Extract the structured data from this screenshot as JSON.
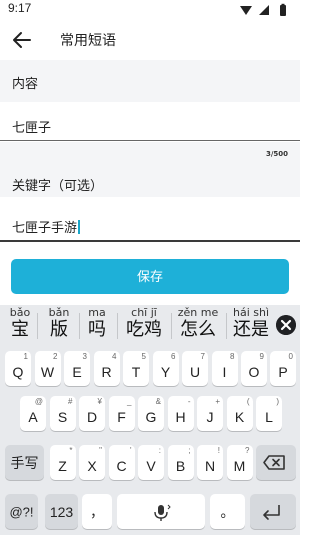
{
  "status": {
    "time": "9:17"
  },
  "app_bar": {
    "title": "常用短语"
  },
  "content": {
    "label": "内容",
    "value": "七匣子",
    "counter": "3/500"
  },
  "keyword": {
    "label": "关键字（可选）",
    "value": "七匣子手游"
  },
  "save_button": {
    "label": "保存"
  },
  "colors": {
    "accent": "#1eb0d8",
    "cursor": "#1aa6c9",
    "keyboard_bg": "#e8eaed",
    "func_key": "#d6d9dd"
  },
  "keyboard": {
    "candidates": [
      {
        "pinyin": "bǎo",
        "hanzi": "宝"
      },
      {
        "pinyin": "bǎn",
        "hanzi": "版"
      },
      {
        "pinyin": "ma",
        "hanzi": "吗"
      },
      {
        "pinyin": "chī jī",
        "hanzi": "吃鸡"
      },
      {
        "pinyin": "zěn me",
        "hanzi": "怎么"
      },
      {
        "pinyin": "hái shì",
        "hanzi": "还是"
      }
    ],
    "row1": [
      {
        "key": "Q",
        "sup": "1"
      },
      {
        "key": "W",
        "sup": "2"
      },
      {
        "key": "E",
        "sup": "3"
      },
      {
        "key": "R",
        "sup": "4"
      },
      {
        "key": "T",
        "sup": "5"
      },
      {
        "key": "Y",
        "sup": "6"
      },
      {
        "key": "U",
        "sup": "7"
      },
      {
        "key": "I",
        "sup": "8"
      },
      {
        "key": "O",
        "sup": "9"
      },
      {
        "key": "P",
        "sup": "0"
      }
    ],
    "row2": [
      {
        "key": "A",
        "sup": "@"
      },
      {
        "key": "S",
        "sup": "#"
      },
      {
        "key": "D",
        "sup": "¥"
      },
      {
        "key": "F",
        "sup": "_"
      },
      {
        "key": "G",
        "sup": "&"
      },
      {
        "key": "H",
        "sup": "-"
      },
      {
        "key": "J",
        "sup": "+"
      },
      {
        "key": "K",
        "sup": "("
      },
      {
        "key": "L",
        "sup": ")"
      }
    ],
    "row3": [
      {
        "key": "Z",
        "sup": "*"
      },
      {
        "key": "X",
        "sup": "\""
      },
      {
        "key": "C",
        "sup": "'"
      },
      {
        "key": "V",
        "sup": ":"
      },
      {
        "key": "B",
        "sup": ";"
      },
      {
        "key": "N",
        "sup": "!"
      },
      {
        "key": "M",
        "sup": "?"
      }
    ],
    "handwriting_label": "手写",
    "symbols_label": "@?!",
    "numbers_label": "123",
    "comma_label": "，",
    "period_label": "。",
    "icons": {
      "backspace": "backspace-icon",
      "mic": "microphone-icon",
      "enter": "enter-icon",
      "close": "close-icon"
    }
  }
}
